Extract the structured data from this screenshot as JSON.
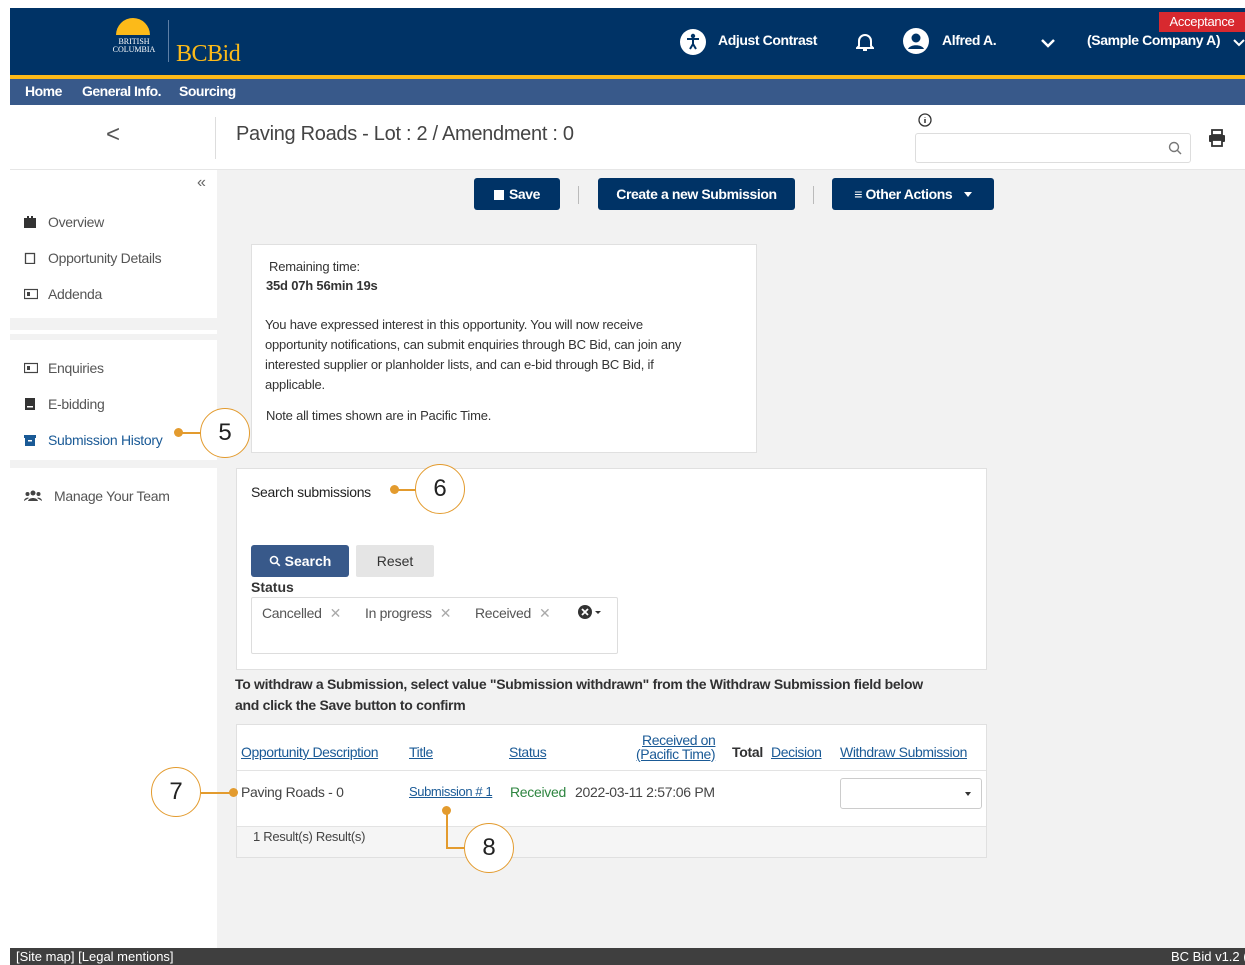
{
  "header": {
    "logo_text": "BRITISH COLUMBIA",
    "brand": "BCBid",
    "adjust_contrast": "Adjust Contrast",
    "user_name": "Alfred A.",
    "company": "(Sample Company A)",
    "badge": "Acceptance"
  },
  "nav": {
    "home": "Home",
    "general": "General Info.",
    "sourcing": "Sourcing"
  },
  "title": {
    "back": "<",
    "page_title": "Paving Roads - Lot : 2 / Amendment : 0"
  },
  "sidebar": {
    "collapse": "«",
    "items": [
      {
        "label": "Overview"
      },
      {
        "label": "Opportunity Details"
      },
      {
        "label": "Addenda"
      },
      {
        "label": "Enquiries"
      },
      {
        "label": "E-bidding"
      },
      {
        "label": "Submission History"
      },
      {
        "label": "Manage Your Team"
      }
    ]
  },
  "toolbar": {
    "save": "Save",
    "create": "Create a new Submission",
    "other": "≡ Other Actions"
  },
  "info": {
    "remaining_label": "Remaining time:",
    "remaining_value": "35d 07h 56min 19s",
    "line1": "You have expressed interest in this opportunity.  You will now receive",
    "line2": "opportunity notifications, can submit enquiries through BC Bid, can join any",
    "line3": "interested supplier or planholder lists, and can e-bid through BC Bid, if",
    "line4": "applicable.",
    "note": "Note all times shown are in Pacific Time."
  },
  "search": {
    "title": "Search submissions",
    "search_btn": "Search",
    "reset_btn": "Reset",
    "status_label": "Status",
    "chips": [
      "Cancelled",
      "In progress",
      "Received"
    ]
  },
  "instructions": {
    "line1": "To withdraw a Submission, select value \"Submission withdrawn\" from the Withdraw Submission field below",
    "line2": "and click the Save button to confirm"
  },
  "table": {
    "headers": {
      "description": "Opportunity Description",
      "title": "Title",
      "status": "Status",
      "received1": "Received on",
      "received2": "(Pacific Time)",
      "total": "Total",
      "decision": "Decision",
      "withdraw": "Withdraw Submission"
    },
    "row": {
      "description": "Paving Roads - 0",
      "title": "Submission # 1",
      "status": "Received",
      "received": "2022-03-11 2:57:06 PM"
    },
    "results": "1 Result(s) Result(s)"
  },
  "footer": {
    "links": "[Site map] [Legal mentions]",
    "version": "BC Bid v1.2 ("
  },
  "callouts": {
    "c5": "5",
    "c6": "6",
    "c7": "7",
    "c8": "8"
  }
}
